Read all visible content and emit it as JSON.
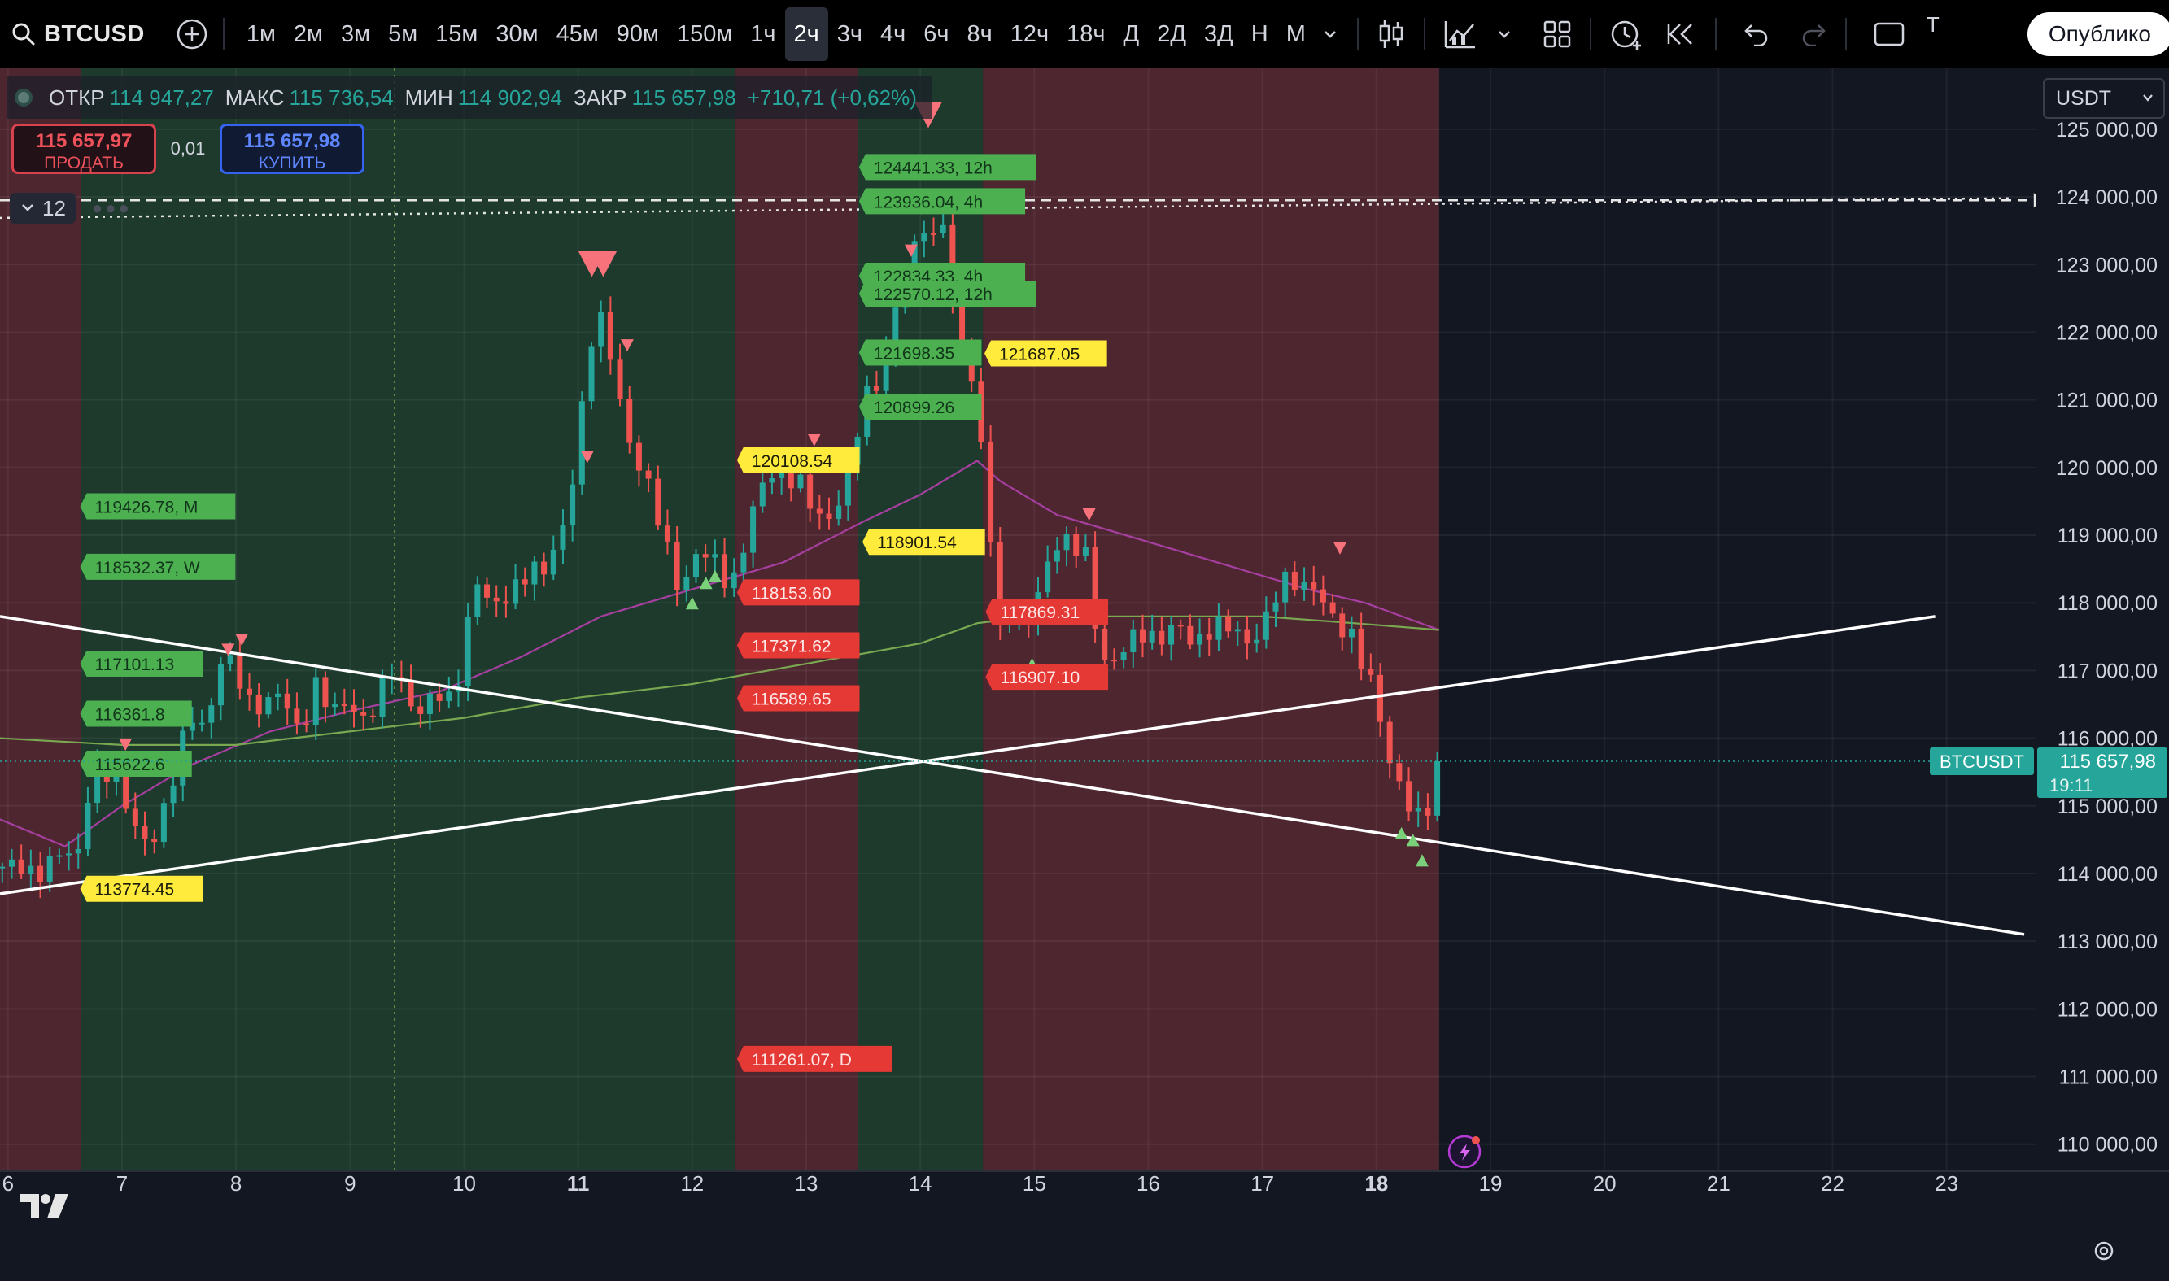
{
  "toolbar": {
    "symbol": "BTCUSD",
    "timeframes": [
      "1м",
      "2м",
      "3м",
      "5м",
      "15м",
      "30м",
      "45м",
      "90м",
      "150м",
      "1ч",
      "2ч",
      "3ч",
      "4ч",
      "6ч",
      "8ч",
      "12ч",
      "18ч",
      "Д",
      "2Д",
      "3Д",
      "Н",
      "М"
    ],
    "active_timeframe": "2ч",
    "cut_text": "T",
    "publish_label": "Опублико"
  },
  "legend": {
    "open_label": "ОТКР",
    "open": "114 947,27",
    "high_label": "МАКС",
    "high": "115 736,54",
    "low_label": "МИН",
    "low": "114 902,94",
    "close_label": "ЗАКР",
    "close": "115 657,98",
    "change": "+710,71 (+0,62%)"
  },
  "trade": {
    "sell_price": "115 657,97",
    "sell_label": "ПРОДАТЬ",
    "spread": "0,01",
    "buy_price": "115 657,98",
    "buy_label": "КУПИТЬ"
  },
  "indicators": {
    "count": "12"
  },
  "quote_currency": "USDT",
  "colors": {
    "up": "#26a69a",
    "down": "#ef5350",
    "green_zone": "#1d3a2c",
    "red_zone": "#4e2630",
    "background": "#131722"
  },
  "chart_data": {
    "type": "candlestick",
    "symbol": "BTCUSDT",
    "ylim": [
      109600,
      125900
    ],
    "y_ticks": [
      110000,
      111000,
      112000,
      113000,
      114000,
      115000,
      116000,
      117000,
      118000,
      119000,
      120000,
      121000,
      122000,
      123000,
      124000,
      125000
    ],
    "y_tick_labels": [
      "110 000,00",
      "111 000,00",
      "112 000,00",
      "113 000,00",
      "114 000,00",
      "115 000,00",
      "116 000,00",
      "117 000,00",
      "118 000,00",
      "119 000,00",
      "120 000,00",
      "121 000,00",
      "122 000,00",
      "123 000,00",
      "124 000,00",
      "125 000,00"
    ],
    "x_labels": [
      {
        "day": 6,
        "label": "6"
      },
      {
        "day": 7,
        "label": "7"
      },
      {
        "day": 8,
        "label": "8"
      },
      {
        "day": 9,
        "label": "9"
      },
      {
        "day": 10,
        "label": "10"
      },
      {
        "day": 11,
        "label": "11",
        "bold": true
      },
      {
        "day": 12,
        "label": "12"
      },
      {
        "day": 13,
        "label": "13"
      },
      {
        "day": 14,
        "label": "14"
      },
      {
        "day": 15,
        "label": "15"
      },
      {
        "day": 16,
        "label": "16"
      },
      {
        "day": 17,
        "label": "17"
      },
      {
        "day": 18,
        "label": "18",
        "bold": true
      },
      {
        "day": 19,
        "label": "19"
      },
      {
        "day": 20,
        "label": "20"
      },
      {
        "day": 21,
        "label": "21"
      },
      {
        "day": 22,
        "label": "22"
      },
      {
        "day": 23,
        "label": "23"
      }
    ],
    "x_range_days": [
      5.93,
      23.78
    ],
    "last_candle_day": 18.55,
    "close_path": [
      [
        5.95,
        114100
      ],
      [
        6.2,
        114000
      ],
      [
        6.45,
        114300
      ],
      [
        6.6,
        114100
      ],
      [
        6.7,
        115200
      ],
      [
        6.8,
        115700
      ],
      [
        7.0,
        115100
      ],
      [
        7.1,
        114700
      ],
      [
        7.25,
        114500
      ],
      [
        7.4,
        115000
      ],
      [
        7.5,
        115700
      ],
      [
        7.6,
        116400
      ],
      [
        7.75,
        116200
      ],
      [
        7.85,
        117100
      ],
      [
        8.0,
        117000
      ],
      [
        8.1,
        116600
      ],
      [
        8.25,
        116500
      ],
      [
        8.4,
        116600
      ],
      [
        8.55,
        116100
      ],
      [
        8.7,
        116800
      ],
      [
        8.85,
        116300
      ],
      [
        9.0,
        116600
      ],
      [
        9.1,
        116300
      ],
      [
        9.25,
        116500
      ],
      [
        9.35,
        117000
      ],
      [
        9.5,
        116700
      ],
      [
        9.6,
        116400
      ],
      [
        9.75,
        116600
      ],
      [
        9.9,
        116500
      ],
      [
        10.1,
        118400
      ],
      [
        10.25,
        117800
      ],
      [
        10.4,
        118200
      ],
      [
        10.55,
        118500
      ],
      [
        10.7,
        118400
      ],
      [
        10.85,
        119000
      ],
      [
        11.0,
        120400
      ],
      [
        11.1,
        121800
      ],
      [
        11.2,
        122100
      ],
      [
        11.3,
        121600
      ],
      [
        11.45,
        120400
      ],
      [
        11.6,
        119700
      ],
      [
        11.75,
        119000
      ],
      [
        11.9,
        118200
      ],
      [
        12.05,
        118700
      ],
      [
        12.2,
        118600
      ],
      [
        12.35,
        118300
      ],
      [
        12.5,
        119100
      ],
      [
        12.65,
        119900
      ],
      [
        12.8,
        120000
      ],
      [
        12.95,
        119700
      ],
      [
        13.1,
        119200
      ],
      [
        13.25,
        119400
      ],
      [
        13.4,
        120100
      ],
      [
        13.5,
        120900
      ],
      [
        13.6,
        121200
      ],
      [
        13.7,
        121700
      ],
      [
        13.8,
        122600
      ],
      [
        13.92,
        123000
      ],
      [
        14.02,
        123600
      ],
      [
        14.1,
        123300
      ],
      [
        14.2,
        123800
      ],
      [
        14.3,
        122100
      ],
      [
        14.4,
        121600
      ],
      [
        14.5,
        120800
      ],
      [
        14.6,
        119400
      ],
      [
        14.7,
        117600
      ],
      [
        14.8,
        117900
      ],
      [
        14.9,
        117500
      ],
      [
        15.0,
        118000
      ],
      [
        15.1,
        118600
      ],
      [
        15.2,
        118900
      ],
      [
        15.3,
        118800
      ],
      [
        15.45,
        118700
      ],
      [
        15.55,
        117600
      ],
      [
        15.65,
        117000
      ],
      [
        15.8,
        117300
      ],
      [
        15.95,
        117600
      ],
      [
        16.1,
        117500
      ],
      [
        16.25,
        117600
      ],
      [
        16.4,
        117400
      ],
      [
        16.55,
        117700
      ],
      [
        16.7,
        117600
      ],
      [
        16.85,
        117400
      ],
      [
        17.0,
        117700
      ],
      [
        17.15,
        118200
      ],
      [
        17.3,
        118300
      ],
      [
        17.45,
        118300
      ],
      [
        17.55,
        118000
      ],
      [
        17.65,
        117500
      ],
      [
        17.75,
        117600
      ],
      [
        17.85,
        117300
      ],
      [
        17.95,
        116900
      ],
      [
        18.05,
        116100
      ],
      [
        18.15,
        115300
      ],
      [
        18.25,
        115200
      ],
      [
        18.35,
        114900
      ],
      [
        18.45,
        115000
      ],
      [
        18.55,
        115658
      ]
    ],
    "moving_averages": [
      {
        "color": "#a63fa0",
        "points": [
          [
            5.93,
            114800
          ],
          [
            6.5,
            114400
          ],
          [
            7.0,
            115000
          ],
          [
            7.6,
            115600
          ],
          [
            8.3,
            116100
          ],
          [
            9.0,
            116400
          ],
          [
            9.8,
            116700
          ],
          [
            10.5,
            117200
          ],
          [
            11.2,
            117800
          ],
          [
            12.0,
            118200
          ],
          [
            12.8,
            118600
          ],
          [
            13.5,
            119200
          ],
          [
            14.0,
            119600
          ],
          [
            14.5,
            120100
          ],
          [
            14.7,
            119800
          ],
          [
            15.2,
            119300
          ],
          [
            16.0,
            118900
          ],
          [
            16.8,
            118500
          ],
          [
            17.4,
            118200
          ],
          [
            17.9,
            118000
          ],
          [
            18.55,
            117600
          ]
        ]
      },
      {
        "color": "#7aa851",
        "points": [
          [
            5.93,
            116000
          ],
          [
            7.0,
            115900
          ],
          [
            8.0,
            115900
          ],
          [
            9.0,
            116100
          ],
          [
            10.0,
            116300
          ],
          [
            11.0,
            116600
          ],
          [
            12.0,
            116800
          ],
          [
            13.0,
            117100
          ],
          [
            14.0,
            117400
          ],
          [
            14.5,
            117700
          ],
          [
            15.0,
            117800
          ],
          [
            16.0,
            117800
          ],
          [
            17.0,
            117800
          ],
          [
            17.8,
            117700
          ],
          [
            18.55,
            117600
          ]
        ]
      }
    ],
    "zones": [
      {
        "from": 5.93,
        "to": 6.64,
        "kind": "red"
      },
      {
        "from": 6.64,
        "to": 12.38,
        "kind": "green"
      },
      {
        "from": 12.38,
        "to": 13.45,
        "kind": "red"
      },
      {
        "from": 13.45,
        "to": 14.55,
        "kind": "green"
      },
      {
        "from": 14.55,
        "to": 18.55,
        "kind": "red"
      }
    ],
    "trend_lines": [
      {
        "from": [
          5.93,
          117800
        ],
        "to": [
          23.68,
          113100
        ]
      },
      {
        "from": [
          5.93,
          113700
        ],
        "to": [
          22.9,
          117800
        ]
      }
    ],
    "hlines": [
      {
        "y": 123950,
        "style": "dashed",
        "from_day": 5.93,
        "to_day": 23.75
      },
      {
        "y": 123690,
        "style": "dotted",
        "from_day": 5.93,
        "to_day": 23.58,
        "end_y": 123980
      }
    ],
    "vline_day": 9.39,
    "level_labels": [
      {
        "day": 6.69,
        "y": 119426.78,
        "text": "119426.78, M",
        "kind": "green"
      },
      {
        "day": 6.69,
        "y": 118532.37,
        "text": "118532.37, W",
        "kind": "green"
      },
      {
        "day": 6.69,
        "y": 117101.13,
        "text": "117101.13",
        "kind": "green"
      },
      {
        "day": 6.69,
        "y": 116361.8,
        "text": "116361.8",
        "kind": "green"
      },
      {
        "day": 6.69,
        "y": 115622.6,
        "text": "115622.6",
        "kind": "green"
      },
      {
        "day": 6.69,
        "y": 113774.45,
        "text": "113774.45",
        "kind": "yellow"
      },
      {
        "day": 13.52,
        "y": 124441.33,
        "text": "124441.33, 12h",
        "kind": "green"
      },
      {
        "day": 13.52,
        "y": 123936.04,
        "text": "123936.04, 4h",
        "kind": "green"
      },
      {
        "day": 13.52,
        "y": 122834.33,
        "text": "122834.33, 4h",
        "kind": "green"
      },
      {
        "day": 13.52,
        "y": 122570.12,
        "text": "122570.12, 12h",
        "kind": "green"
      },
      {
        "day": 13.52,
        "y": 121698.35,
        "text": "121698.35",
        "kind": "green"
      },
      {
        "day": 13.52,
        "y": 120899.26,
        "text": "120899.26",
        "kind": "green"
      },
      {
        "day": 14.62,
        "y": 121687.05,
        "text": "121687.05",
        "kind": "yellow"
      },
      {
        "day": 12.45,
        "y": 120108.54,
        "text": "120108.54",
        "kind": "yellow"
      },
      {
        "day": 13.55,
        "y": 118901.54,
        "text": "118901.54",
        "kind": "yellow"
      },
      {
        "day": 12.45,
        "y": 118153.6,
        "text": "118153.60",
        "kind": "red"
      },
      {
        "day": 12.45,
        "y": 117371.62,
        "text": "117371.62",
        "kind": "red"
      },
      {
        "day": 12.45,
        "y": 116589.65,
        "text": "116589.65",
        "kind": "red"
      },
      {
        "day": 14.63,
        "y": 117869.31,
        "text": "117869.31",
        "kind": "red"
      },
      {
        "day": 14.63,
        "y": 116907.1,
        "text": "116907.10",
        "kind": "red"
      },
      {
        "day": 12.45,
        "y": 111261.07,
        "text": "111261.07, D",
        "kind": "red"
      }
    ],
    "markers": [
      {
        "day": 7.03,
        "y": 115900,
        "dir": "down"
      },
      {
        "day": 7.93,
        "y": 117300,
        "dir": "down"
      },
      {
        "day": 8.05,
        "y": 117450,
        "dir": "down"
      },
      {
        "day": 11.12,
        "y": 123000,
        "dir": "down",
        "big": true
      },
      {
        "day": 11.22,
        "y": 123000,
        "dir": "down",
        "big": true
      },
      {
        "day": 11.08,
        "y": 120150,
        "dir": "down"
      },
      {
        "day": 11.43,
        "y": 121800,
        "dir": "down"
      },
      {
        "day": 12.0,
        "y": 118000,
        "dir": "up"
      },
      {
        "day": 12.12,
        "y": 118300,
        "dir": "up"
      },
      {
        "day": 12.2,
        "y": 118400,
        "dir": "up"
      },
      {
        "day": 13.07,
        "y": 120400,
        "dir": "down"
      },
      {
        "day": 14.07,
        "y": 125200,
        "dir": "down",
        "big": true
      },
      {
        "day": 13.92,
        "y": 123200,
        "dir": "down"
      },
      {
        "day": 14.98,
        "y": 117100,
        "dir": "up"
      },
      {
        "day": 15.48,
        "y": 119300,
        "dir": "down"
      },
      {
        "day": 17.68,
        "y": 118800,
        "dir": "down"
      },
      {
        "day": 18.22,
        "y": 114600,
        "dir": "up"
      },
      {
        "day": 18.32,
        "y": 114500,
        "dir": "up"
      },
      {
        "day": 18.4,
        "y": 114200,
        "dir": "up"
      }
    ],
    "price_tag": {
      "symbol": "BTCUSDT",
      "price": "115 657,98",
      "countdown": "19:11",
      "value": 115657.98
    }
  }
}
